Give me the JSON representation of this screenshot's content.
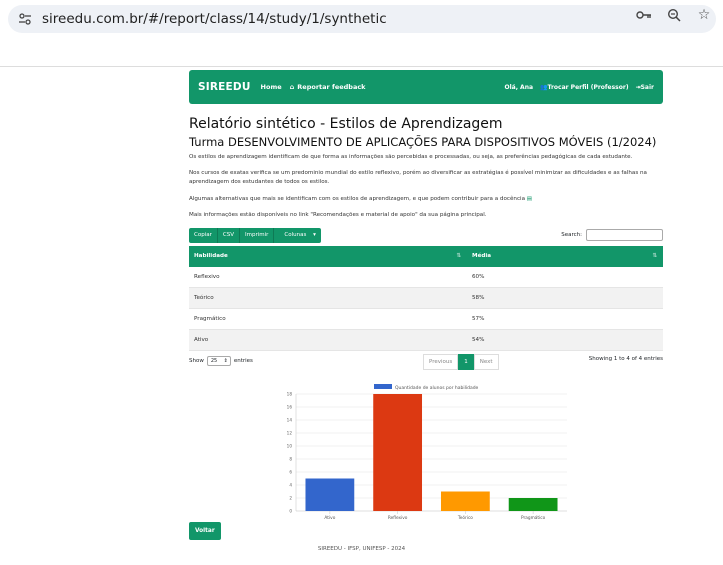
{
  "browser": {
    "url": "sireedu.com.br/#/report/class/14/study/1/synthetic",
    "icons": [
      "tune-icon",
      "key-icon",
      "zoom-icon",
      "star-icon"
    ]
  },
  "navbar": {
    "brand": "SIREEDU",
    "home": "Home",
    "feedback": "Reportar feedback",
    "greeting": "Olá, Ana",
    "switch_profile": "Trocar Perfil (Professor)",
    "logout": "Sair"
  },
  "page": {
    "title": "Relatório sintético - Estilos de Aprendizagem",
    "subtitle": "Turma DESENVOLVIMENTO DE APLICAÇÕES PARA DISPOSITIVOS MÓVEIS (1/2024)",
    "p1": "Os estilos de aprendizagem identificam de que forma as informações são percebidas e processadas, ou seja, as preferências pedagógicas de cada estudante.",
    "p2": "Nos cursos de exatas verifica se um predominio mundial do estilo reflexivo, porém ao diversificar as estratégias é possível minimizar as dificuldades e as falhas na aprendizagem dos estudantes de todos os estilos.",
    "p3": "Algumas alternativas que mais se identificam com os estilos de aprendizagem, e que podem contribuir para a docência",
    "p4": "Mais informações estão disponíveis no link \"Recomendações e material de apoio\" da sua página principal."
  },
  "toolbar": {
    "copy": "Copiar",
    "csv": "CSV",
    "print": "Imprimir",
    "columns": "Colunas",
    "search_label": "Search:"
  },
  "table": {
    "headers": [
      "Habilidade",
      "Média"
    ],
    "rows": [
      [
        "Reflexivo",
        "60%"
      ],
      [
        "Teórico",
        "58%"
      ],
      [
        "Pragmático",
        "57%"
      ],
      [
        "Ativo",
        "54%"
      ]
    ]
  },
  "pagination": {
    "show": "Show",
    "entries_value": "25",
    "entries": "entries",
    "previous": "Previous",
    "current": "1",
    "next": "Next",
    "info": "Showing 1 to 4 of 4 entries"
  },
  "chart_data": {
    "type": "bar",
    "categories": [
      "Ativo",
      "Reflexivo",
      "Teórico",
      "Pragmático"
    ],
    "series": [
      {
        "name": "Quantidade de alunos por habilidade",
        "values": [
          5,
          18,
          3,
          2
        ]
      }
    ],
    "colors": [
      "#3366cc",
      "#dc3912",
      "#ff9900",
      "#109618"
    ],
    "ylim": [
      0,
      18
    ],
    "yticks": [
      0,
      2,
      4,
      6,
      8,
      10,
      12,
      14,
      16,
      18
    ],
    "legend": "top",
    "grid": true
  },
  "buttons": {
    "back": "Voltar"
  },
  "footer": "SIREEDU - IFSP, UNIFESP - 2024",
  "colors": {
    "primary": "#129669"
  }
}
